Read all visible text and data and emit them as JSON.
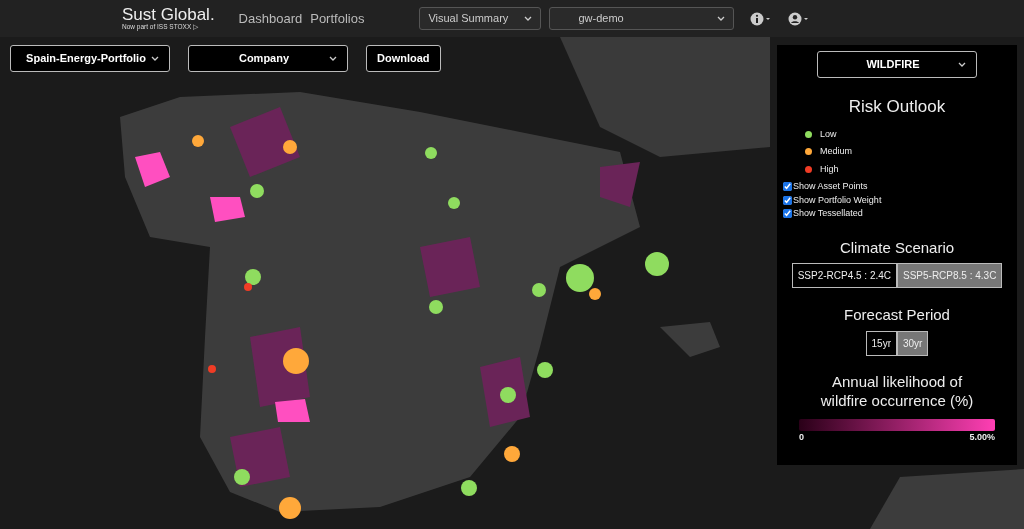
{
  "brand": {
    "name": "Sust Global.",
    "tagline": "Now part of ISS STOXX ▷"
  },
  "nav": [
    {
      "label": "Dashboard"
    },
    {
      "label": "Portfolios"
    }
  ],
  "header_selects": [
    {
      "value": "Visual Summary"
    },
    {
      "value": "gw-demo"
    }
  ],
  "map_controls": {
    "portfolio": "Spain-Energy-Portfolio",
    "grouping": "Company",
    "download": "Download"
  },
  "panel": {
    "hazard": "WILDFIRE",
    "title": "Risk Outlook",
    "legend": [
      {
        "label": "Low",
        "color": "#8fdc5f"
      },
      {
        "label": "Medium",
        "color": "#ffa83a"
      },
      {
        "label": "High",
        "color": "#f03c25"
      }
    ],
    "toggles": [
      {
        "label": "Show Asset Points",
        "checked": true
      },
      {
        "label": "Show Portfolio Weight",
        "checked": true
      },
      {
        "label": "Show Tessellated",
        "checked": true
      }
    ],
    "scenario_title": "Climate Scenario",
    "scenarios": [
      {
        "label": "SSP2-RCP4.5 : 2.4C",
        "selected": false
      },
      {
        "label": "SSP5-RCP8.5 : 4.3C",
        "selected": true
      }
    ],
    "period_title": "Forecast Period",
    "periods": [
      {
        "label": "15yr",
        "selected": false
      },
      {
        "label": "30yr",
        "selected": true
      }
    ],
    "scale_title": "Annual likelihood of wildfire occurrence (%)",
    "scale_min": "0",
    "scale_max": "5.00%"
  }
}
